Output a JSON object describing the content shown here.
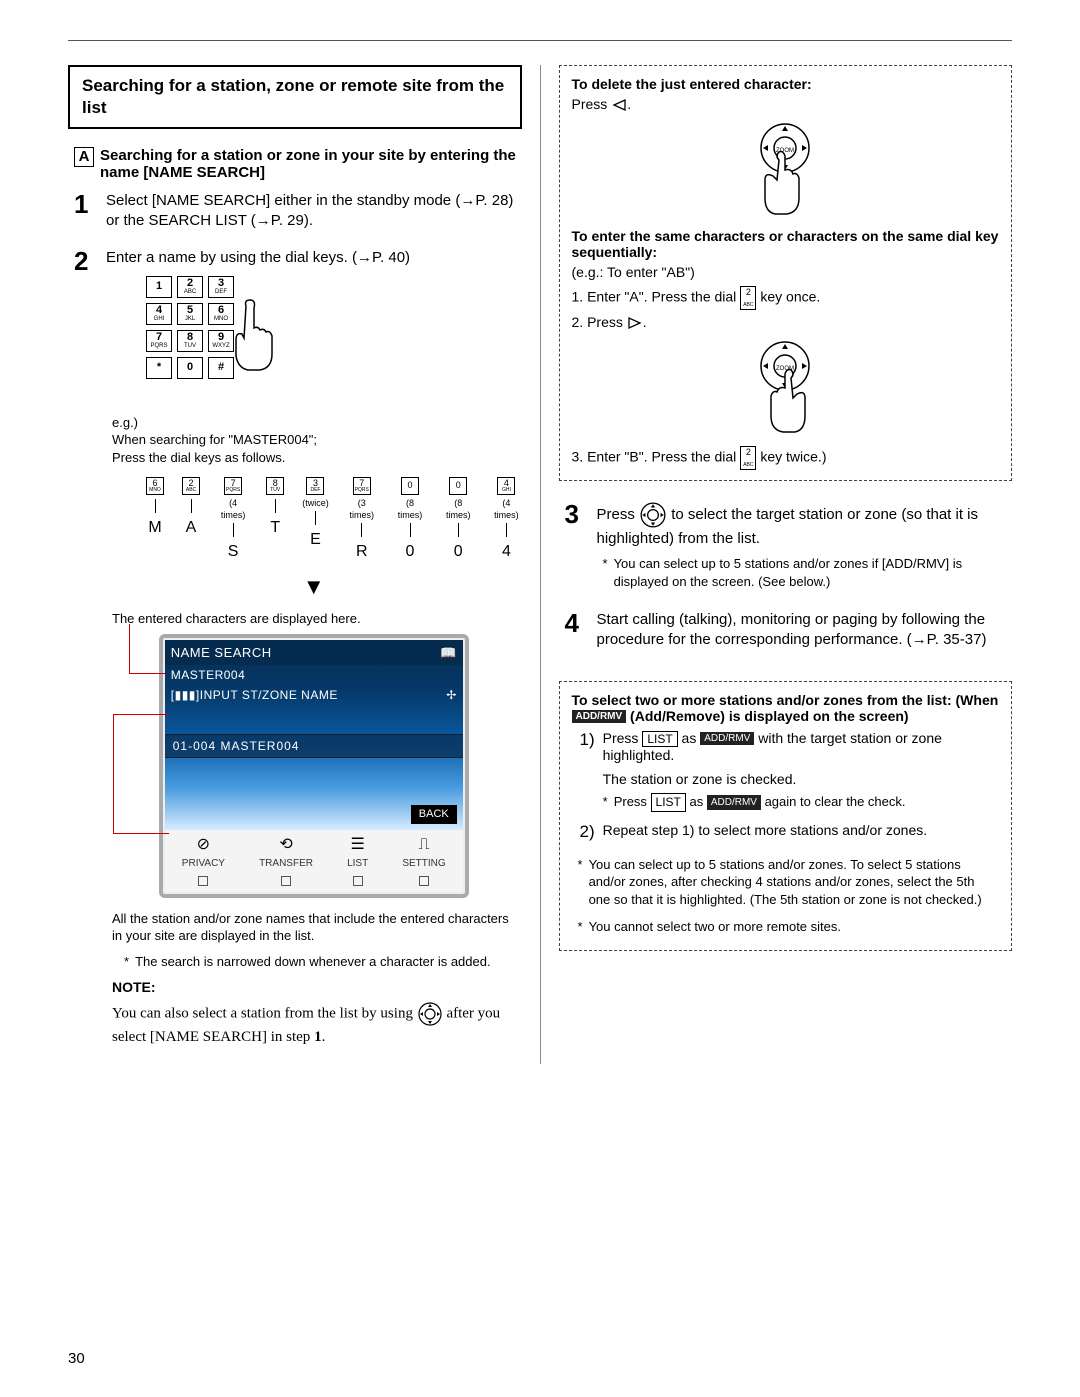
{
  "page_number": "30",
  "title": "Searching for a station, zone or remote site from the list",
  "section_A_letter": "A",
  "section_A_heading": "Searching for a station or zone in your site by entering the name [NAME SEARCH]",
  "step1": "Select [NAME SEARCH] either in the standby mode (→P. 28) or the SEARCH LIST (→P. 29).",
  "step2": "Enter a name by using the dial keys. (→P. 40)",
  "keypad": [
    {
      "n": "1",
      "l": ""
    },
    {
      "n": "2",
      "l": "ABC"
    },
    {
      "n": "3",
      "l": "DEF"
    },
    {
      "n": "4",
      "l": "GHI"
    },
    {
      "n": "5",
      "l": "JKL"
    },
    {
      "n": "6",
      "l": "MNO"
    },
    {
      "n": "7",
      "l": "PQRS"
    },
    {
      "n": "8",
      "l": "TUV"
    },
    {
      "n": "9",
      "l": "WXYZ"
    },
    {
      "n": "*",
      "l": ""
    },
    {
      "n": "0",
      "l": ""
    },
    {
      "n": "#",
      "l": ""
    }
  ],
  "example_label": "e.g.)",
  "example_text1": "When searching for \"MASTER004\";",
  "example_text2": "Press the dial keys as follows.",
  "dial_sequence": [
    {
      "key_n": "6",
      "key_l": "MNO",
      "times": "",
      "letter": "M"
    },
    {
      "key_n": "2",
      "key_l": "ABC",
      "times": "",
      "letter": "A"
    },
    {
      "key_n": "7",
      "key_l": "PQRS",
      "times": "(4 times)",
      "letter": "S"
    },
    {
      "key_n": "8",
      "key_l": "TUV",
      "times": "",
      "letter": "T"
    },
    {
      "key_n": "3",
      "key_l": "DEF",
      "times": "(twice)",
      "letter": "E"
    },
    {
      "key_n": "7",
      "key_l": "PQRS",
      "times": "(3 times)",
      "letter": "R"
    },
    {
      "key_n": "0",
      "key_l": "",
      "times": "(8 times)",
      "letter": "0"
    },
    {
      "key_n": "0",
      "key_l": "",
      "times": "(8 times)",
      "letter": "0"
    },
    {
      "key_n": "4",
      "key_l": "GHI",
      "times": "(4 times)",
      "letter": "4"
    }
  ],
  "caption_top": "The entered characters are displayed here.",
  "screen": {
    "line1": "NAME SEARCH",
    "line2": "MASTER004",
    "line3": "[▮▮▮]INPUT ST/ZONE NAME",
    "row": "01-004   MASTER004",
    "back": "BACK",
    "bottom": [
      {
        "icon": "⊘",
        "label": "PRIVACY"
      },
      {
        "icon": "⟲",
        "label": "TRANSFER"
      },
      {
        "icon": "☰",
        "label": "LIST"
      },
      {
        "icon": "⎍",
        "label": "SETTING"
      }
    ]
  },
  "caption_bottom": "All the station and/or zone names that include the entered characters in your site are displayed in the list.",
  "bullet_narrow": "The search is narrowed down whenever a character is added.",
  "note_label": "NOTE:",
  "note_text_a": "You can also select a station from the list by using ",
  "note_text_b": " after you select [NAME SEARCH] in step ",
  "note_step": "1",
  "box1": {
    "h1": "To delete the just entered character:",
    "t1": "Press ",
    "h2": "To enter the same characters or characters on the same dial key sequentially:",
    "eg": "(e.g.: To enter \"AB\")",
    "s1": "1. Enter \"A\". Press the dial ",
    "s1b": " key once.",
    "s2": "2. Press ",
    "s3": "3. Enter \"B\". Press the dial ",
    "s3b": " key twice.)",
    "key2_n": "2",
    "key2_l": "ABC"
  },
  "step3_a": "Press ",
  "step3_b": " to select the target station or zone (so that it is highlighted) from the list.",
  "step3_bullet": "You can select up to 5 stations and/or zones if [ADD/RMV] is displayed on the screen. (See below.)",
  "step4": "Start calling (talking), monitoring or paging by following the procedure for the corresponding performance.  (→P. 35-37)",
  "box2": {
    "h_a": "To select two or more stations and/or zones from the list: (When ",
    "h_b": " (Add/Remove) is displayed on the screen)",
    "addremv": "ADD/RMV",
    "s1a": "Press ",
    "list_btn": "LIST",
    "s1b": " as ",
    "s1c": " with the target station or zone highlighted.",
    "checked": "The station or zone is checked.",
    "s1d_a": "Press ",
    "s1d_b": " as ",
    "s1d_c": " again to clear the check.",
    "s2": "Repeat step 1) to select more stations and/or zones.",
    "b1": "You can select up to 5 stations and/or zones. To select 5 stations and/or zones, after checking 4 stations and/or zones, select the 5th one so that it is highlighted. (The 5th station or zone is not checked.)",
    "b2": "You cannot select two or more remote sites."
  }
}
